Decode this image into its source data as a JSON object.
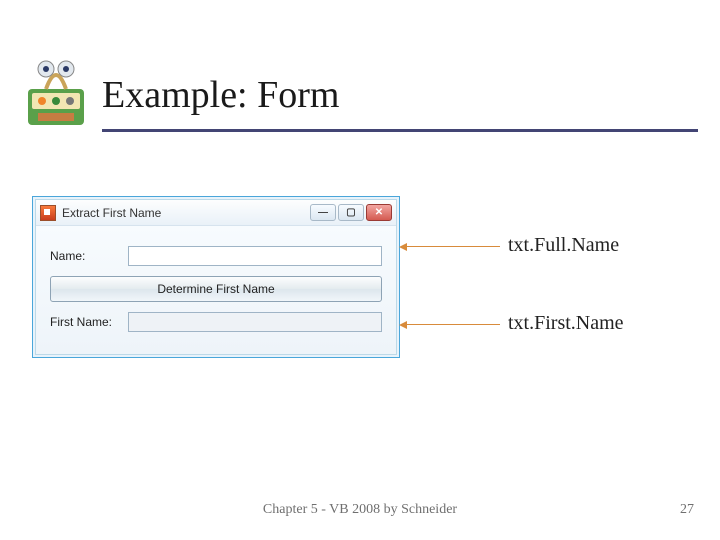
{
  "title": "Example: Form",
  "window": {
    "title": "Extract First Name",
    "labels": {
      "name": "Name:",
      "first": "First Name:"
    },
    "button": "Determine First Name",
    "controls": {
      "min": "—",
      "max": "▢",
      "close": "✕"
    }
  },
  "callouts": {
    "full": "txt.Full.Name",
    "first": "txt.First.Name"
  },
  "footer": "Chapter 5 - VB 2008 by Schneider",
  "page": "27"
}
